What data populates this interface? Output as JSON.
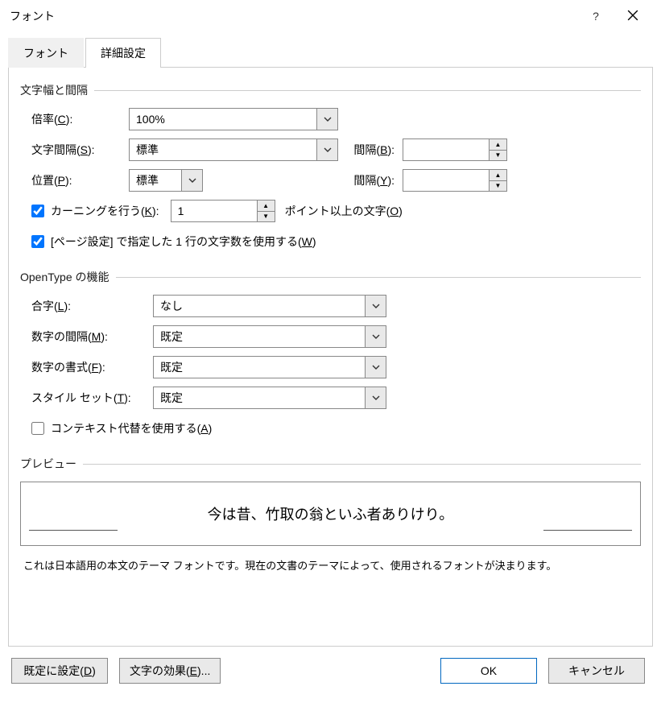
{
  "title": "フォント",
  "tabs": {
    "font": "フォント",
    "advanced": "詳細設定"
  },
  "spacing": {
    "group": "文字幅と間隔",
    "scale_label_pre": "倍率(",
    "scale_hot": "C",
    "scale_label_post": "):",
    "scale_value": "100%",
    "spacing_label_pre": "文字間隔(",
    "spacing_hot": "S",
    "spacing_label_post": "):",
    "spacing_value": "標準",
    "by1_label_pre": "間隔(",
    "by1_hot": "B",
    "by1_label_post": "):",
    "by1_value": "",
    "pos_label_pre": "位置(",
    "pos_hot": "P",
    "pos_label_post": "):",
    "pos_value": "標準",
    "by2_label_pre": "間隔(",
    "by2_hot": "Y",
    "by2_label_post": "):",
    "by2_value": "",
    "kern_label_pre": "カーニングを行う(",
    "kern_hot": "K",
    "kern_label_post": "):",
    "kern_value": "1",
    "kern_after_pre": "ポイント以上の文字(",
    "kern_after_hot": "O",
    "kern_after_post": ")",
    "grid_label_pre": "[ページ設定] で指定した 1 行の文字数を使用する(",
    "grid_hot": "W",
    "grid_label_post": ")"
  },
  "ot": {
    "group": "OpenType の機能",
    "lig_label_pre": "合字(",
    "lig_hot": "L",
    "lig_label_post": "):",
    "lig_value": "なし",
    "numsp_label_pre": "数字の間隔(",
    "numsp_hot": "M",
    "numsp_label_post": "):",
    "numsp_value": "既定",
    "numfmt_label_pre": "数字の書式(",
    "numfmt_hot": "F",
    "numfmt_label_post": "):",
    "numfmt_value": "既定",
    "styleset_label_pre": "スタイル セット(",
    "styleset_hot": "T",
    "styleset_label_post": "):",
    "styleset_value": "既定",
    "ctx_label_pre": "コンテキスト代替を使用する(",
    "ctx_hot": "A",
    "ctx_label_post": ")"
  },
  "preview": {
    "group": "プレビュー",
    "text": "今は昔、竹取の翁といふ者ありけり。",
    "desc": "これは日本語用の本文のテーマ フォントです。現在の文書のテーマによって、使用されるフォントが決まります。"
  },
  "footer": {
    "default_pre": "既定に設定(",
    "default_hot": "D",
    "default_post": ")",
    "effects_pre": "文字の効果(",
    "effects_hot": "E",
    "effects_post": ")...",
    "ok": "OK",
    "cancel": "キャンセル"
  }
}
